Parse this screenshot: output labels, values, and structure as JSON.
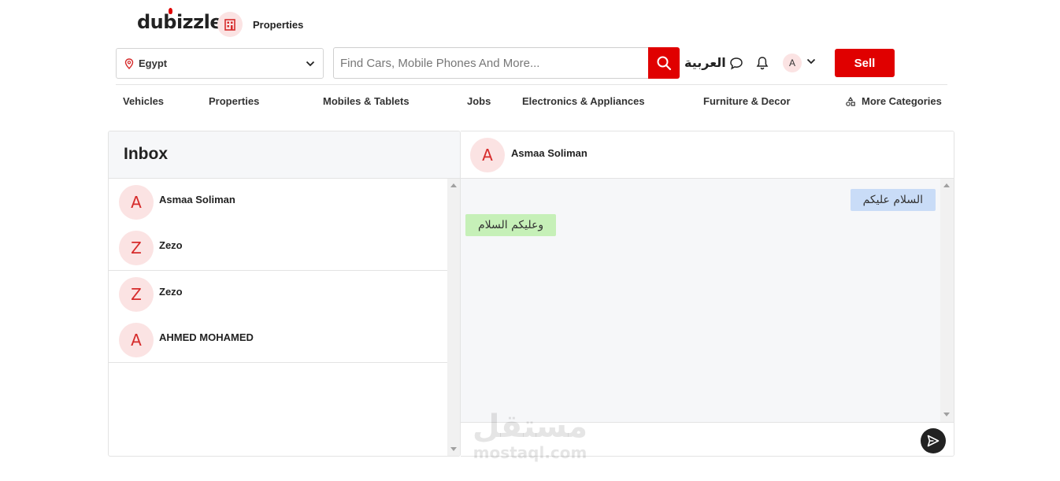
{
  "header": {
    "logo_text": "dubizzle",
    "category_label": "Properties",
    "location": "Egypt",
    "search_placeholder": "Find Cars, Mobile Phones And More...",
    "language_label": "العربية",
    "user_initial": "A",
    "sell_label": "Sell"
  },
  "nav": {
    "items": [
      "Vehicles",
      "Properties",
      "Mobiles & Tablets",
      "Jobs",
      "Electronics & Appliances",
      "Furniture & Decor",
      "More Categories"
    ]
  },
  "inbox": {
    "title": "Inbox",
    "conversations": [
      {
        "initial": "A",
        "name": "Asmaa Soliman"
      },
      {
        "initial": "Z",
        "name": "Zezo"
      },
      {
        "initial": "Z",
        "name": "Zezo"
      },
      {
        "initial": "A",
        "name": "AHMED MOHAMED"
      }
    ]
  },
  "chat": {
    "contact_initial": "A",
    "contact_name": "Asmaa Soliman",
    "messages": [
      {
        "direction": "outgoing",
        "text": "السلام عليكم"
      },
      {
        "direction": "incoming",
        "text": "وعليكم السلام"
      }
    ]
  },
  "watermark": {
    "arabic": "مستقل",
    "latin": "mostaql.com"
  },
  "colors": {
    "brand_red": "#e00000",
    "avatar_bg": "#fbe3e3",
    "outgoing_bubble": "#c9dcf7",
    "incoming_bubble": "#c6f0b8"
  }
}
